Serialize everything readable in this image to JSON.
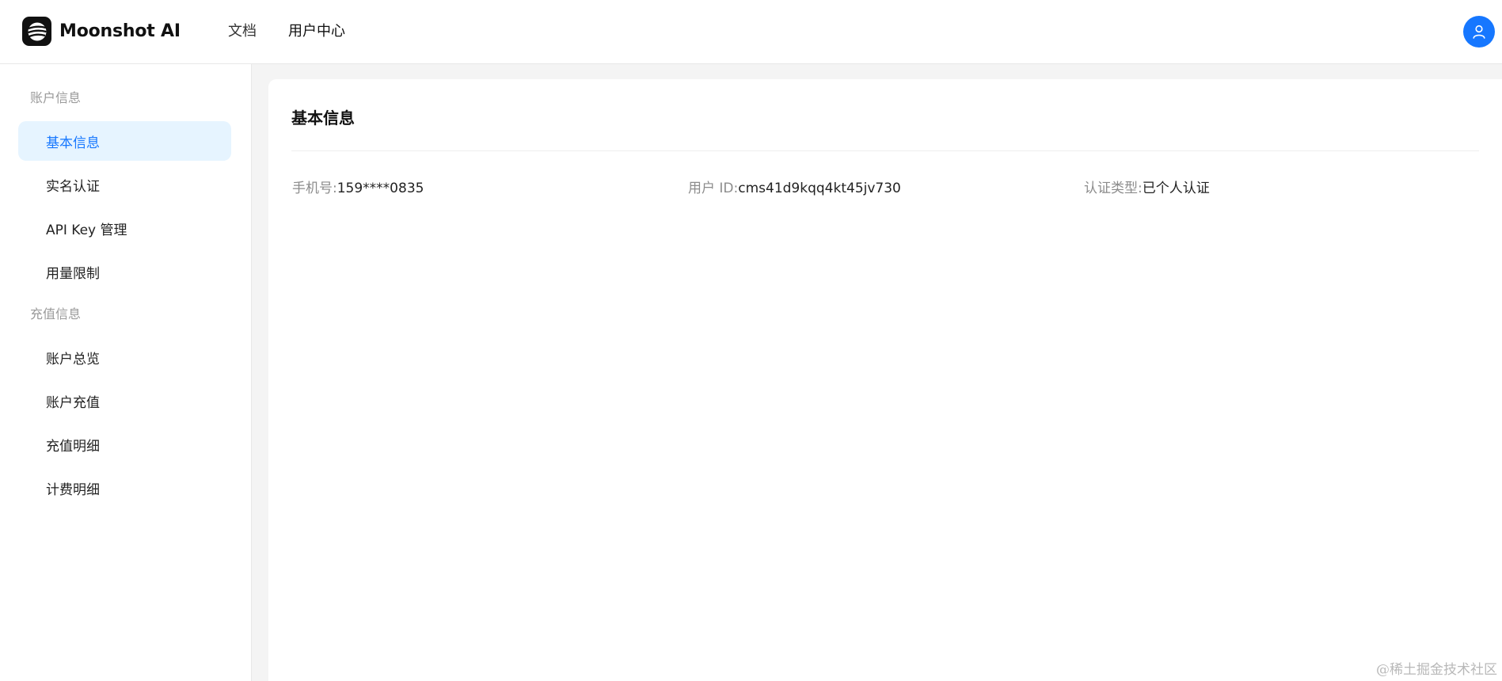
{
  "header": {
    "brand": "Moonshot AI",
    "brand_icon": "moonshot-logo-icon",
    "nav": [
      "文档",
      "用户中心"
    ],
    "active_nav": "用户中心",
    "avatar_icon": "user-icon",
    "accent_color": "#1677ff"
  },
  "sidebar": {
    "groups": [
      {
        "title": "账户信息",
        "items": [
          "基本信息",
          "实名认证",
          "API Key 管理",
          "用量限制"
        ]
      },
      {
        "title": "充值信息",
        "items": [
          "账户总览",
          "账户充值",
          "充值明细",
          "计费明细"
        ]
      }
    ],
    "active_item": "基本信息"
  },
  "main": {
    "title": "基本信息",
    "fields": [
      {
        "label": "手机号:",
        "value": "159****0835"
      },
      {
        "label": "用户 ID:",
        "value": "cms41d9kqq4kt45jv730"
      },
      {
        "label": "认证类型:",
        "value": "已个人认证"
      }
    ]
  },
  "watermark": "@稀土掘金技术社区"
}
